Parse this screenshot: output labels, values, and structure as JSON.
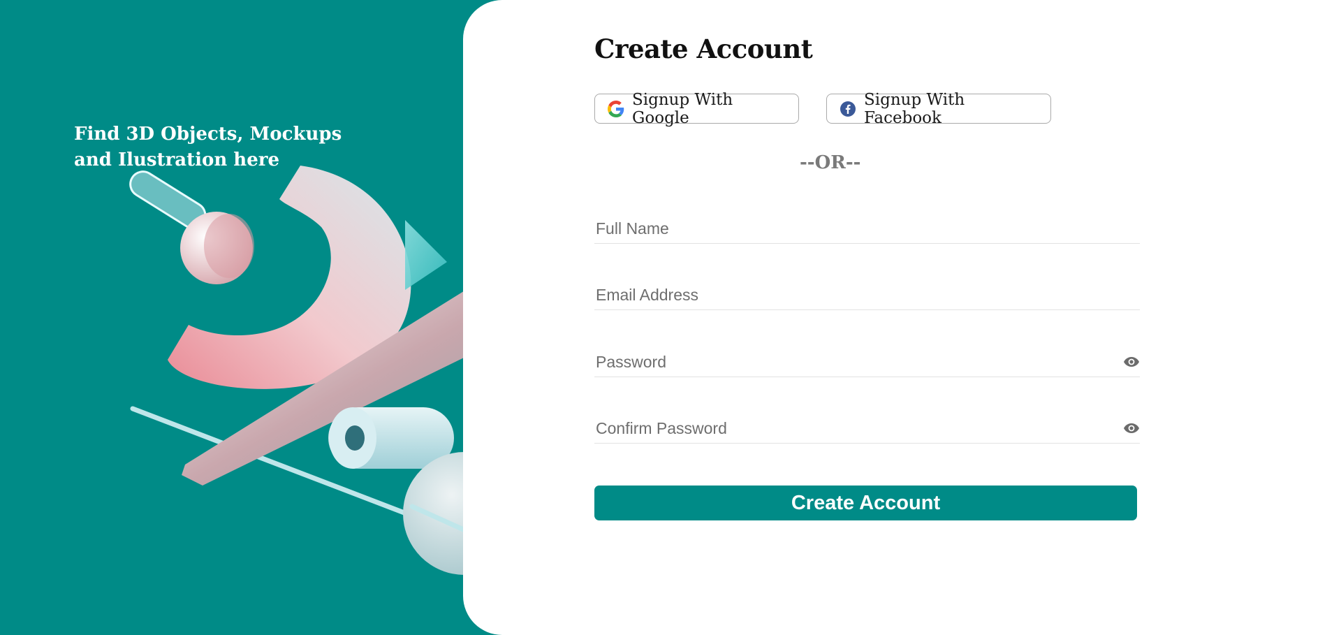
{
  "hero": {
    "tagline": "Find 3D Objects, Mockups and Ilustration here",
    "background_color": "#008b87"
  },
  "form": {
    "title": "Create Account",
    "social": {
      "google_label": "Signup With Google",
      "google_icon": "google-g-icon",
      "facebook_label": "Signup With Facebook",
      "facebook_icon": "facebook-f-icon"
    },
    "divider": "--OR--",
    "fields": {
      "full_name": {
        "placeholder": "Full Name",
        "value": ""
      },
      "email": {
        "placeholder": "Email Address",
        "value": ""
      },
      "password": {
        "placeholder": "Password",
        "value": "",
        "icon": "eye-icon"
      },
      "confirm_password": {
        "placeholder": "Confirm Password",
        "value": "",
        "icon": "eye-icon"
      }
    },
    "submit_label": "Create Account",
    "accent_color": "#008b87"
  }
}
